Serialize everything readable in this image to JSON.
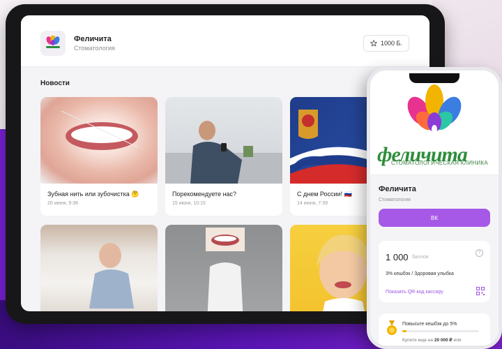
{
  "tablet": {
    "header": {
      "app_name": "Феличита",
      "app_subtitle": "Стоматология",
      "points_badge": "1000 Б."
    },
    "section_title": "Новости",
    "news": [
      {
        "title": "Зубная нить или зубочистка 🤔",
        "date": "20 июня, 9:36"
      },
      {
        "title": "Порекомендуете нас?",
        "date": "15 июня, 10:15"
      },
      {
        "title": "С днем России! 🇷🇺",
        "date": "14 июня, 7:39"
      },
      {
        "title": "",
        "date": ""
      },
      {
        "title": "",
        "date": ""
      },
      {
        "title": "",
        "date": ""
      }
    ]
  },
  "phone": {
    "brand_logo_text": "феличита",
    "brand_logo_subtitle": "СТОМАТОЛОГИЧЕСКАЯ КЛИНИКА",
    "name": "Феличита",
    "subtitle": "Стоматология",
    "vk_button": "ВК",
    "points_value": "1 000",
    "points_label": "баллов",
    "cashback_text": "3% кешбэк / Здоровая улыбка",
    "qr_link": "Показать QR-код кассиру",
    "upgrade_title": "Повысьте кешбэк до 5%",
    "upgrade_prefix": "Купите еще на ",
    "upgrade_amount": "20 000 ₽",
    "upgrade_suffix": " или",
    "upgrade_progress": 0.05
  },
  "colors": {
    "accent_purple": "#a658e6",
    "brand_green": "#2e8d3b",
    "link_purple": "#9a55e0"
  }
}
